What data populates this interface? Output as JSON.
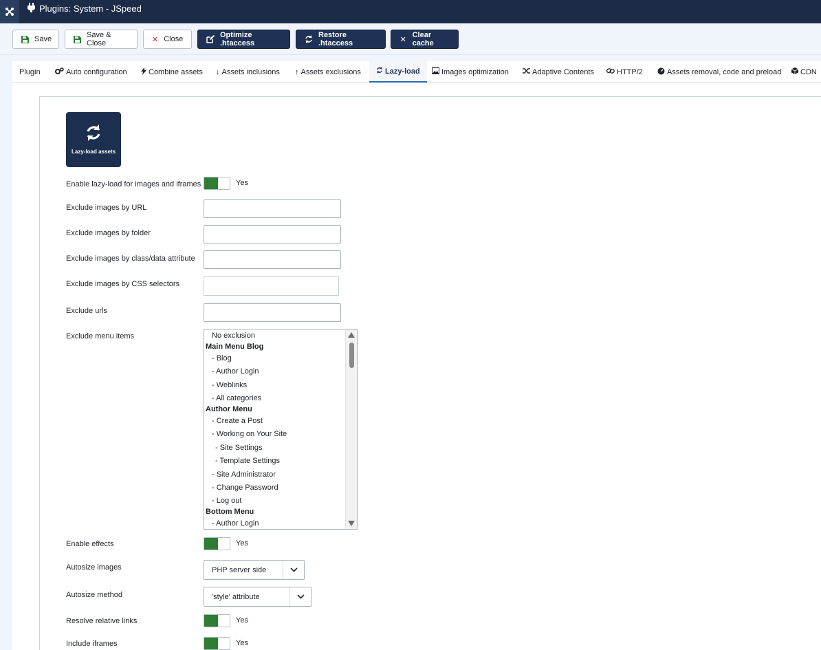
{
  "header": {
    "title": "Plugins: System - JSpeed",
    "logo_icon": "joomla-icon",
    "title_icon": "plug-icon"
  },
  "toolbar": {
    "save": "Save",
    "save_close": "Save & Close",
    "close": "Close",
    "optimize": "Optimize .htaccess",
    "restore": "Restore .htaccess",
    "clear_cache": "Clear cache"
  },
  "tabs": [
    {
      "label": "Plugin",
      "icon": ""
    },
    {
      "label": "Auto configuration",
      "icon": "cogs-icon"
    },
    {
      "label": "Combine assets",
      "icon": "bolt-icon"
    },
    {
      "label": "Assets inclusions",
      "icon": "arrow-down-icon"
    },
    {
      "label": "Assets exclusions",
      "icon": "arrow-up-icon"
    },
    {
      "label": "Lazy-load",
      "icon": "refresh-icon",
      "active": true
    },
    {
      "label": "Images optimization",
      "icon": "image-icon"
    },
    {
      "label": "Adaptive Contents",
      "icon": "random-icon"
    },
    {
      "label": "HTTP/2",
      "icon": "link-icon"
    },
    {
      "label": "Assets removal, code and preload",
      "icon": "dashboard-icon"
    },
    {
      "label": "CDN",
      "icon": "cube-icon"
    }
  ],
  "feature_card": {
    "label": "Lazy-load assets",
    "icon": "refresh-icon"
  },
  "fields": {
    "enable_lazyload": {
      "label": "Enable lazy-load for images and iframes",
      "state": "Yes"
    },
    "exclude_url": {
      "label": "Exclude images by URL",
      "value": ""
    },
    "exclude_folder": {
      "label": "Exclude images by folder",
      "value": ""
    },
    "exclude_class": {
      "label": "Exclude images by class/data attribute",
      "value": ""
    },
    "exclude_css": {
      "label": "Exclude images by CSS selectors",
      "value": ""
    },
    "exclude_urls": {
      "label": "Exclude urls",
      "value": ""
    },
    "exclude_menu": {
      "label": "Exclude menu items"
    },
    "enable_effects": {
      "label": "Enable effects",
      "state": "Yes"
    },
    "autosize_images": {
      "label": "Autosize images",
      "value": "PHP server side"
    },
    "autosize_method": {
      "label": "Autosize method",
      "value": "'style' attribute"
    },
    "resolve_links": {
      "label": "Resolve relative links",
      "state": "Yes"
    },
    "include_iframes": {
      "label": "Include iframes",
      "state": "Yes"
    }
  },
  "menu_items": [
    {
      "text": "No exclusion",
      "indent": 1,
      "group": false
    },
    {
      "text": "Main Menu Blog",
      "indent": 0,
      "group": true
    },
    {
      "text": "- Blog",
      "indent": 1,
      "group": false
    },
    {
      "text": "- Author Login",
      "indent": 1,
      "group": false
    },
    {
      "text": "- Weblinks",
      "indent": 1,
      "group": false
    },
    {
      "text": "- All categories",
      "indent": 1,
      "group": false
    },
    {
      "text": "Author Menu",
      "indent": 0,
      "group": true
    },
    {
      "text": "- Create a Post",
      "indent": 1,
      "group": false
    },
    {
      "text": "- Working on Your Site",
      "indent": 1,
      "group": false
    },
    {
      "text": "- Site Settings",
      "indent": 2,
      "group": false
    },
    {
      "text": "- Template Settings",
      "indent": 2,
      "group": false
    },
    {
      "text": "- Site Administrator",
      "indent": 1,
      "group": false
    },
    {
      "text": "- Change Password",
      "indent": 1,
      "group": false
    },
    {
      "text": "- Log out",
      "indent": 1,
      "group": false
    },
    {
      "text": "Bottom Menu",
      "indent": 0,
      "group": true
    },
    {
      "text": "- Author Login",
      "indent": 1,
      "group": false
    }
  ],
  "colors": {
    "header_bg": "#1c2c48",
    "dark_button": "#1f3256",
    "switch_on": "#2e7d32"
  }
}
